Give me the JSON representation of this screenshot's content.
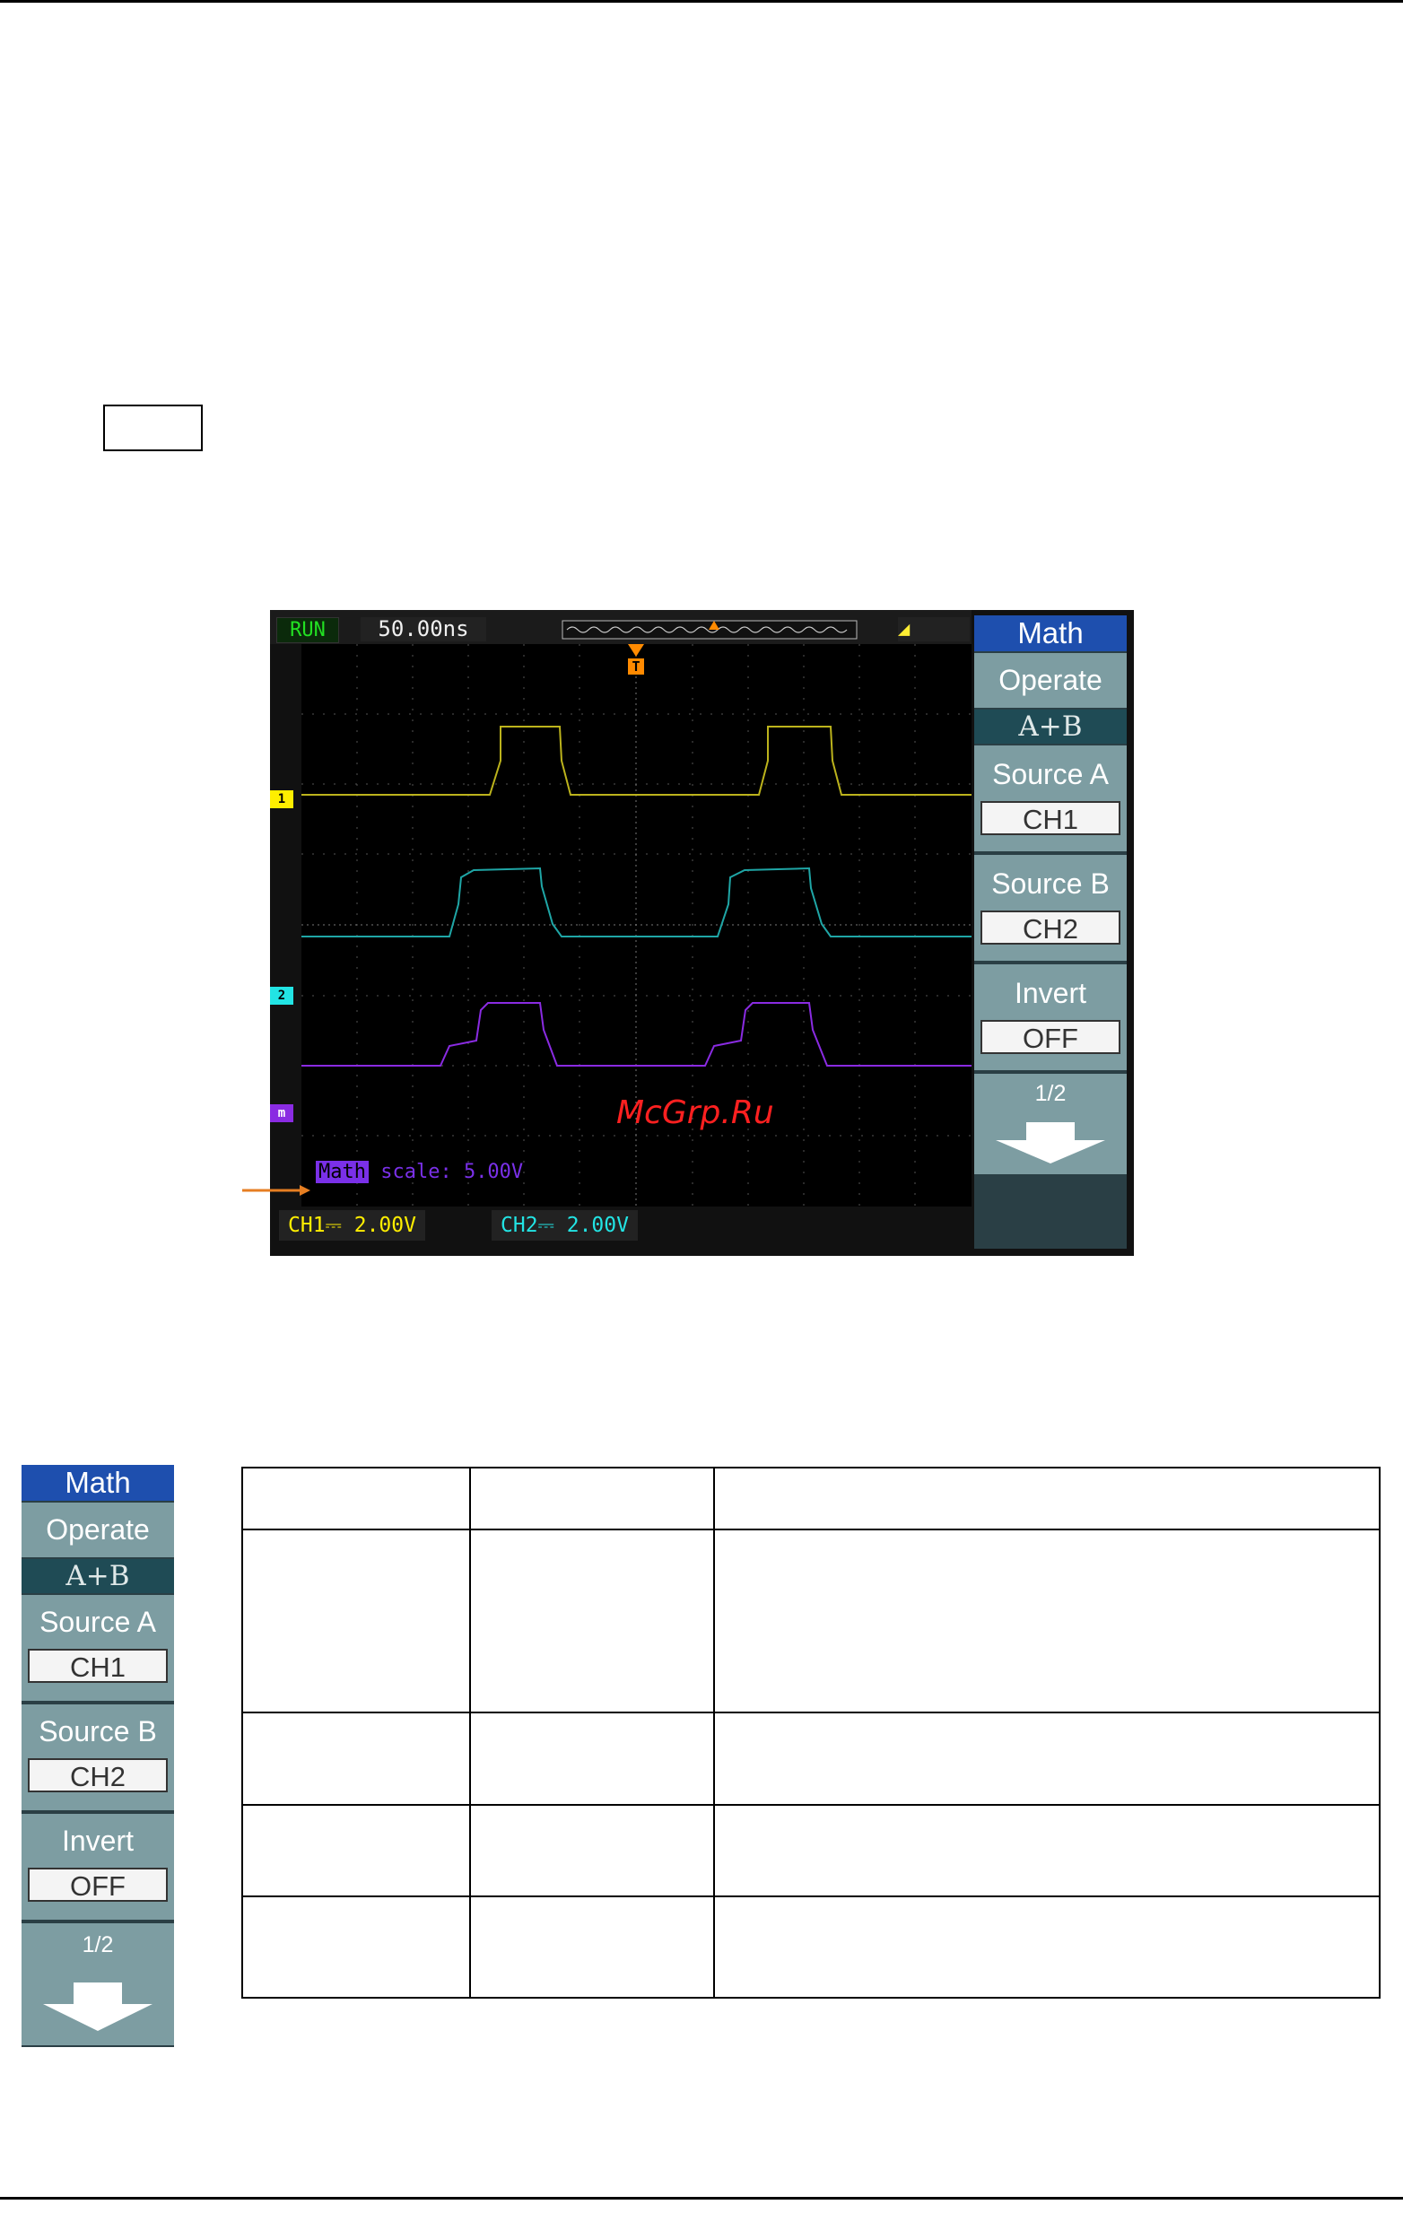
{
  "scope": {
    "run_state": "RUN",
    "timebase": "50.00ns",
    "trigger_marker": "T",
    "channel_markers": [
      "1",
      "2",
      "m"
    ],
    "math_tag": "Math",
    "math_scale": " scale: 5.00V",
    "ch1_readout": "CH1⎓ 2.00V",
    "ch2_readout": "CH2⎓ 2.00V",
    "watermark": "McGrp.Ru",
    "trace_colors": {
      "ch1": "#bcb31c",
      "ch2": "#1fa6a6",
      "math": "#8a2be2"
    }
  },
  "menu": {
    "title": "Math",
    "operate_label": "Operate",
    "operate_value": "A+B",
    "source_a_label": "Source A",
    "source_a_value": "CH1",
    "source_b_label": "Source B",
    "source_b_value": "CH2",
    "invert_label": "Invert",
    "invert_value": "OFF",
    "page": "1/2"
  }
}
